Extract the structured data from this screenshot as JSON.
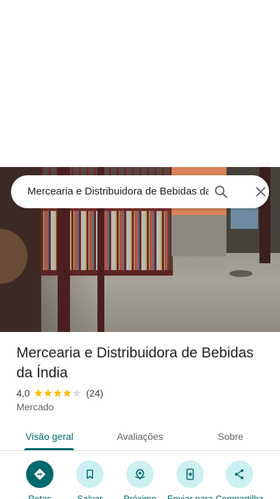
{
  "search": {
    "query": "Mercearia e Distribuidora de Bebidas da Índia"
  },
  "place": {
    "title": "Mercearia e Distribuidora de Bebidas da Índia",
    "rating": "4,0",
    "rating_stars": 4,
    "review_count": "(24)",
    "category": "Mercado"
  },
  "tabs": [
    {
      "label": "Visão geral",
      "selected": true
    },
    {
      "label": "Avaliações",
      "selected": false
    },
    {
      "label": "Sobre",
      "selected": false
    }
  ],
  "actions": [
    {
      "label": "Rotas",
      "icon": "directions-icon"
    },
    {
      "label": "Salvar",
      "icon": "bookmark-icon"
    },
    {
      "label": "Próximo",
      "icon": "nearby-icon"
    },
    {
      "label": "Enviar para",
      "icon": "send-to-phone-icon"
    },
    {
      "label": "Compartilha",
      "icon": "share-icon"
    }
  ],
  "colors": {
    "accent": "#00696b",
    "accent_light": "#ccf0f1",
    "star": "#fbbc04"
  }
}
